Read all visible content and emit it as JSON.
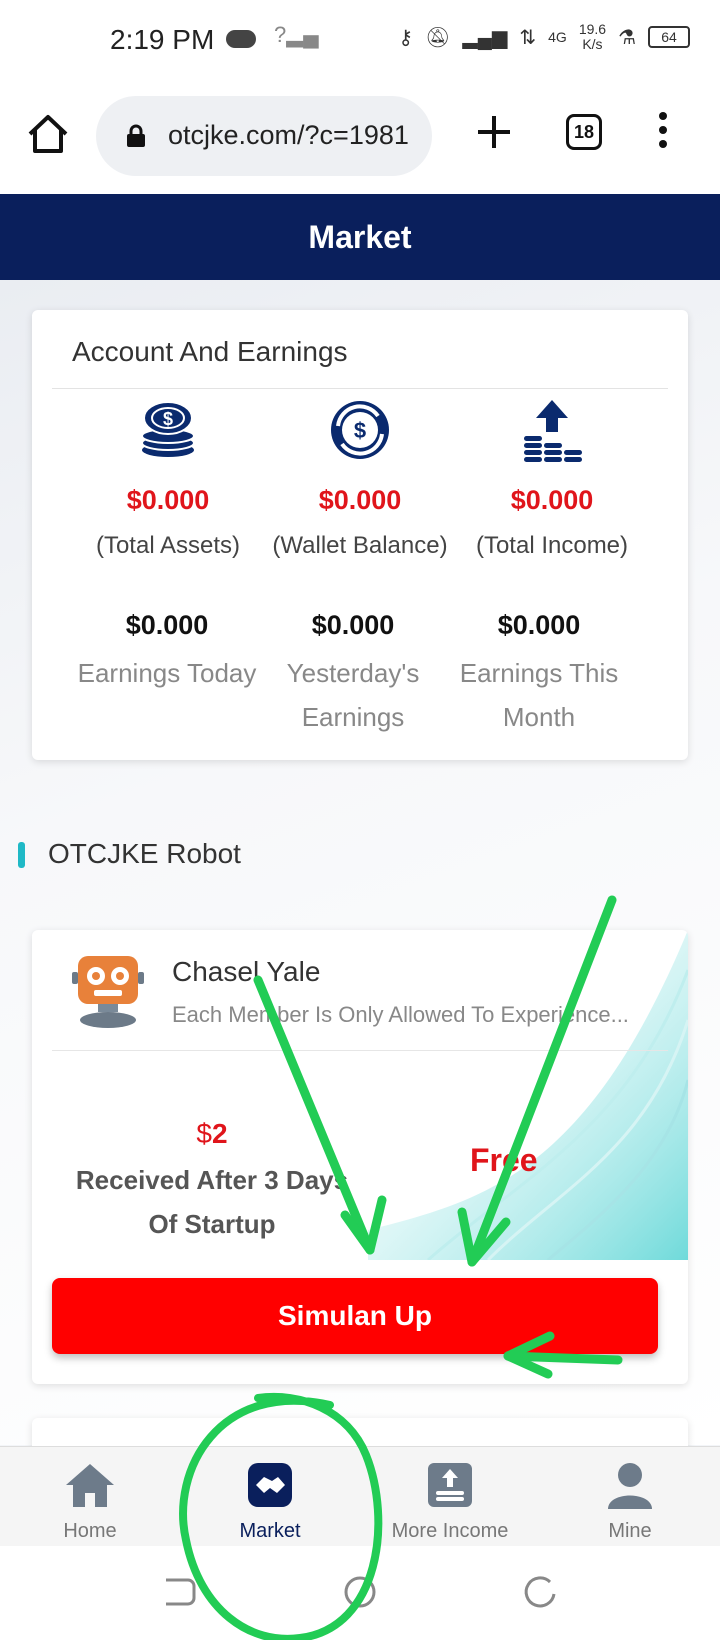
{
  "status_bar": {
    "time": "2:19 PM",
    "network": "4G",
    "speed": "19.6",
    "speed_unit": "K/s",
    "battery": "64"
  },
  "browser": {
    "url": "otcjke.com/?c=1981",
    "tab_count": "18"
  },
  "header": {
    "title": "Market"
  },
  "account": {
    "title": "Account And Earnings",
    "stats": [
      {
        "value": "$0.000",
        "label": "(Total Assets)",
        "icon": "coins-dollar-icon"
      },
      {
        "value": "$0.000",
        "label": "(Wallet Balance)",
        "icon": "dollar-refresh-icon"
      },
      {
        "value": "$0.000",
        "label": "(Total Income)",
        "icon": "coin-stacks-up-icon"
      }
    ],
    "earnings": [
      {
        "value": "$0.000",
        "label": "Earnings Today"
      },
      {
        "value": "$0.000",
        "label": "Yesterday's Earnings"
      },
      {
        "value": "$0.000",
        "label": "Earnings This Month"
      }
    ]
  },
  "section": {
    "title": "OTCJKE Robot"
  },
  "robot": {
    "name": "Chasel Yale",
    "description": "Each Member Is Only Allowed To Experience...",
    "currency": "$",
    "amount": "2",
    "reward_label": "Received After 3 Days Of Startup",
    "price": "Free",
    "button": "Simulan Up"
  },
  "tabs": [
    {
      "label": "Home",
      "icon": "home-icon"
    },
    {
      "label": "Market",
      "icon": "handshake-icon"
    },
    {
      "label": "More Income",
      "icon": "coins-upload-icon"
    },
    {
      "label": "Mine",
      "icon": "user-icon"
    }
  ],
  "colors": {
    "brand_navy": "#0a1f5c",
    "accent_red": "#e0151b",
    "button_red": "#ff0000",
    "annotation_green": "#22cc55"
  }
}
